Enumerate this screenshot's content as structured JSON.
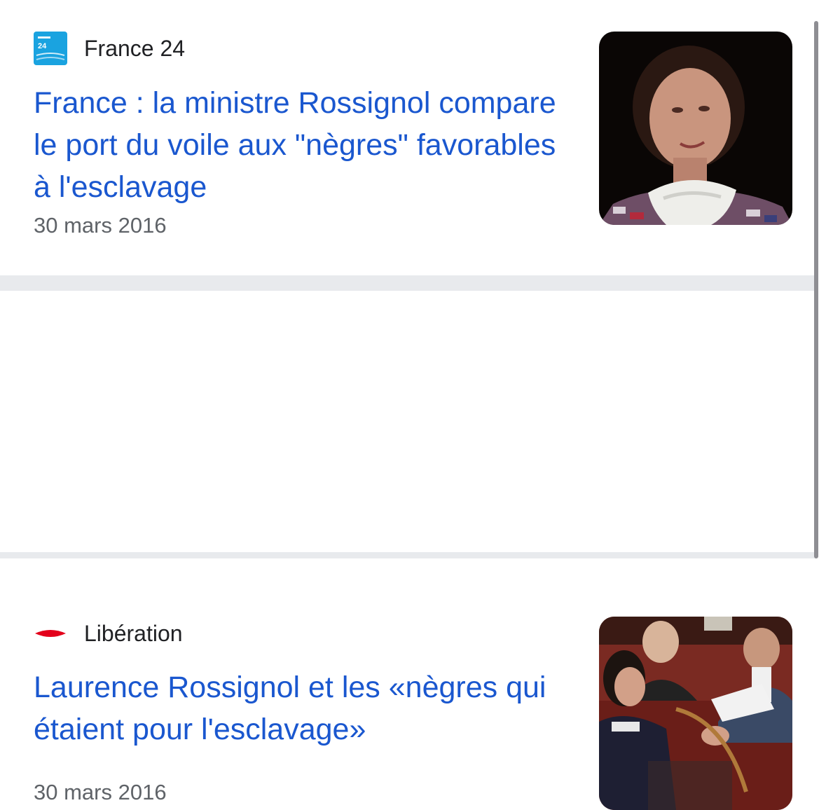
{
  "articles": [
    {
      "source": "France 24",
      "source_logo_icon": "france24-logo-icon",
      "source_logo_text": "FRANCE 24",
      "headline": "France : la ministre Rossignol compare le port du voile aux \"nègres\" favorables à l'esclavage",
      "date": "30 mars 2016",
      "thumbnail_icon": "portrait-thumbnail"
    },
    {
      "source": "Libération",
      "source_logo_icon": "liberation-logo-icon",
      "headline": "Laurence Rossignol et les «nègres qui étaient pour l'esclavage»",
      "date": "30 mars 2016",
      "thumbnail_icon": "assembly-photo-thumbnail"
    }
  ],
  "colors": {
    "headline": "#1a57cf",
    "date": "#5f6368",
    "divider": "#e8eaed",
    "france24_blue": "#1aa3e0",
    "liberation_red": "#e3001b"
  }
}
